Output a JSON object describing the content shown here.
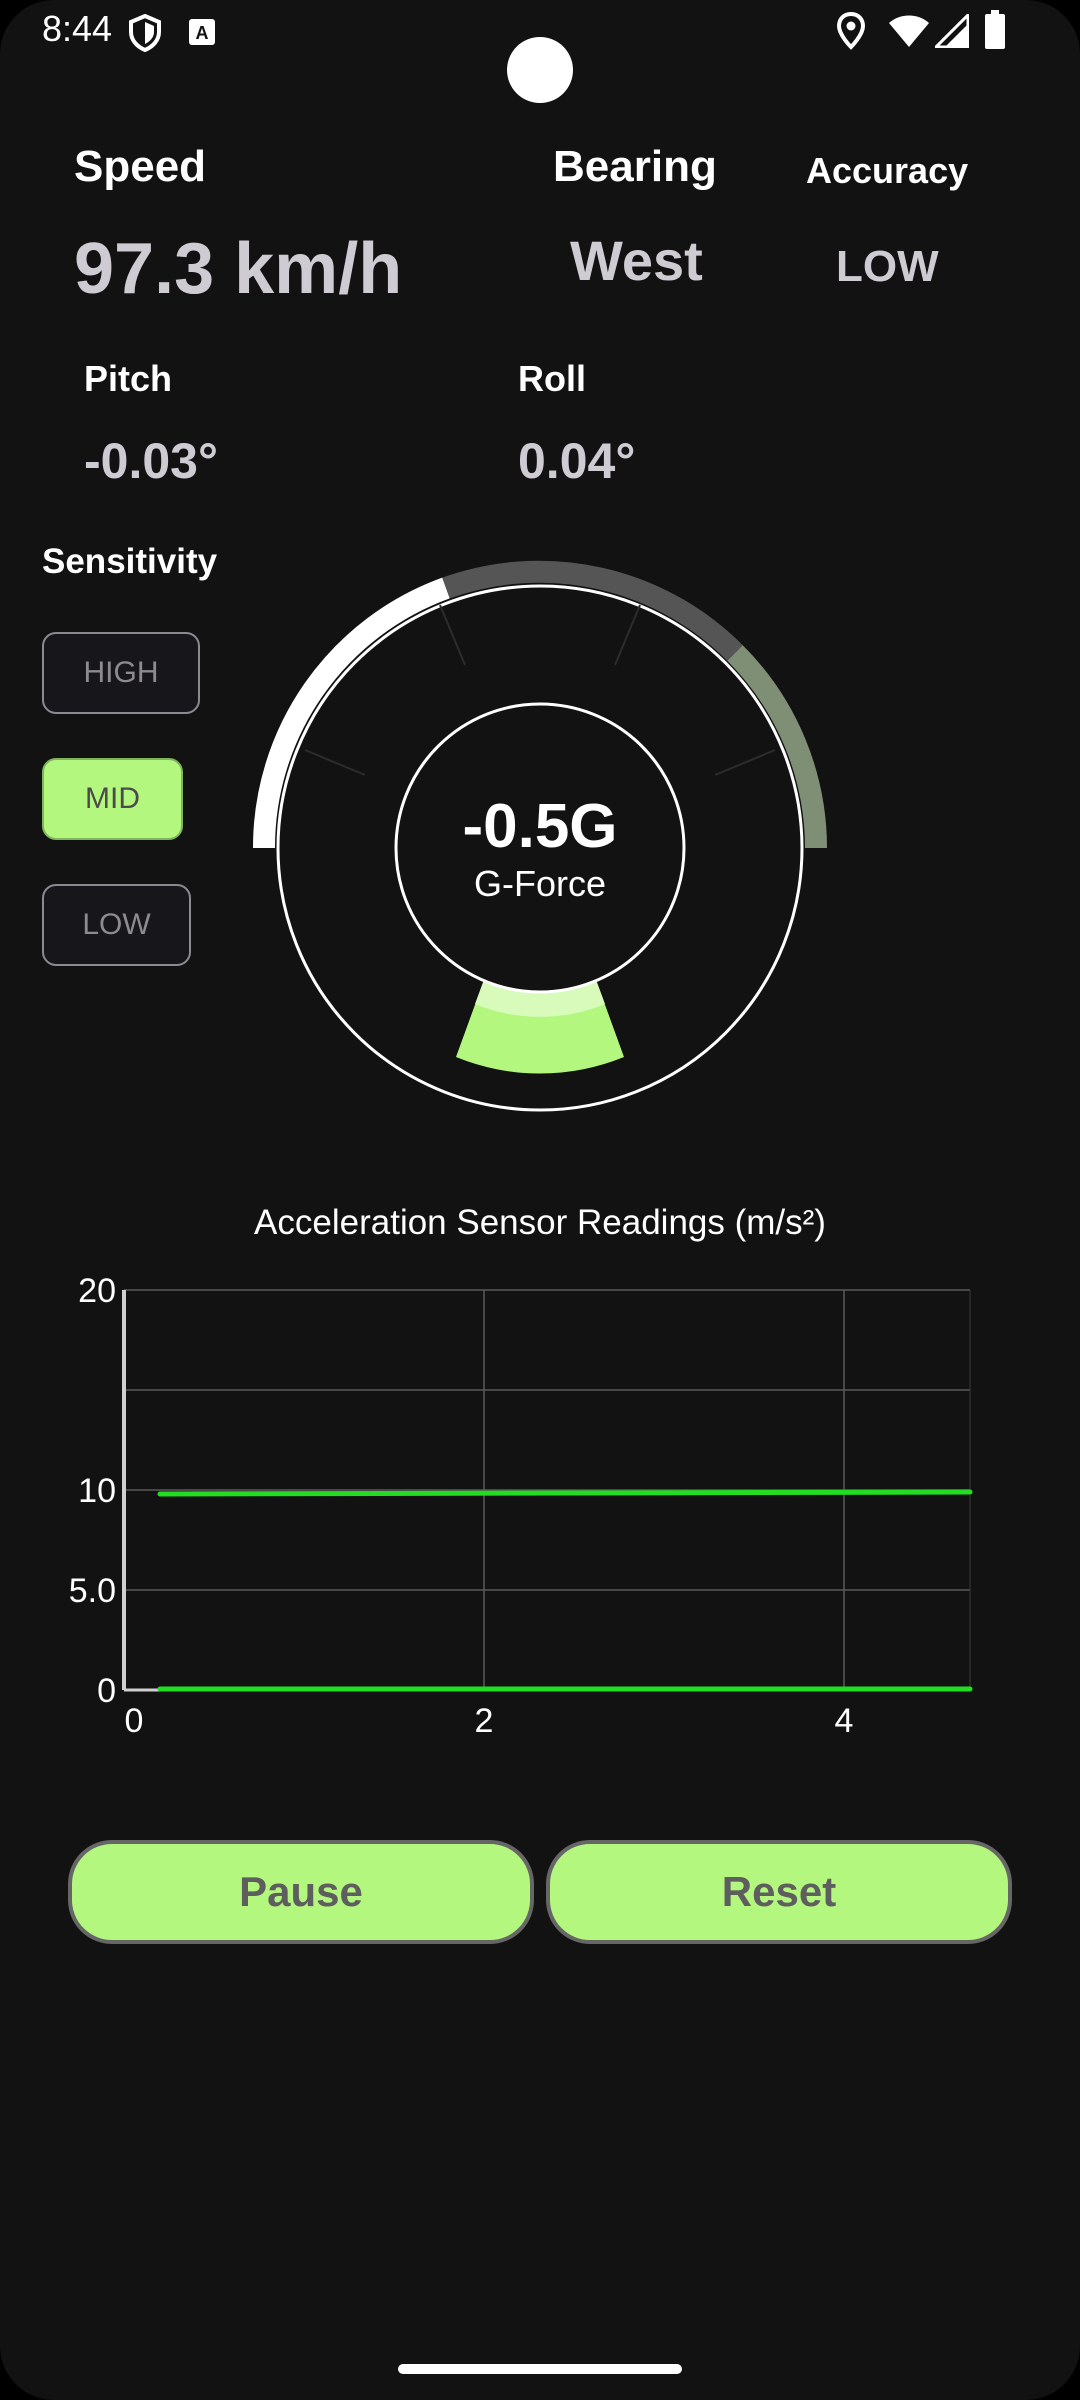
{
  "status_bar": {
    "time": "8:44",
    "left_icons": [
      "shield-icon",
      "keyboard-a-icon"
    ],
    "right_icons": [
      "location-icon",
      "wifi-icon",
      "signal-icon",
      "battery-icon"
    ]
  },
  "metrics": {
    "speed_label": "Speed",
    "speed_value": "97.3 km/h",
    "bearing_label": "Bearing",
    "bearing_value": "West",
    "accuracy_label": "Accuracy",
    "accuracy_value": "LOW",
    "pitch_label": "Pitch",
    "pitch_value": "-0.03°",
    "roll_label": "Roll",
    "roll_value": "0.04°"
  },
  "sensitivity": {
    "label": "Sensitivity",
    "options": [
      "HIGH",
      "MID",
      "LOW"
    ],
    "selected": "MID"
  },
  "gauge": {
    "value_text": "-0.5G",
    "caption": "G-Force"
  },
  "chart_data": {
    "type": "line",
    "title": "Acceleration Sensor Readings (m/s²)",
    "x_ticks": [
      "0",
      "2",
      "4"
    ],
    "y_ticks": [
      "0",
      "5.0",
      "10",
      "20"
    ],
    "xlim": [
      0,
      4.7
    ],
    "ylim": [
      0,
      20
    ],
    "grid": true,
    "series": [
      {
        "x": [
          0.2,
          4.7
        ],
        "values": [
          9.8,
          9.9
        ]
      },
      {
        "x": [
          0.2,
          4.7
        ],
        "values": [
          0.05,
          0.05
        ]
      }
    ],
    "series_color": "#22dd22"
  },
  "buttons": {
    "pause_label": "Pause",
    "reset_label": "Reset"
  },
  "colors": {
    "accent": "#b3f77f",
    "background": "#121212"
  }
}
